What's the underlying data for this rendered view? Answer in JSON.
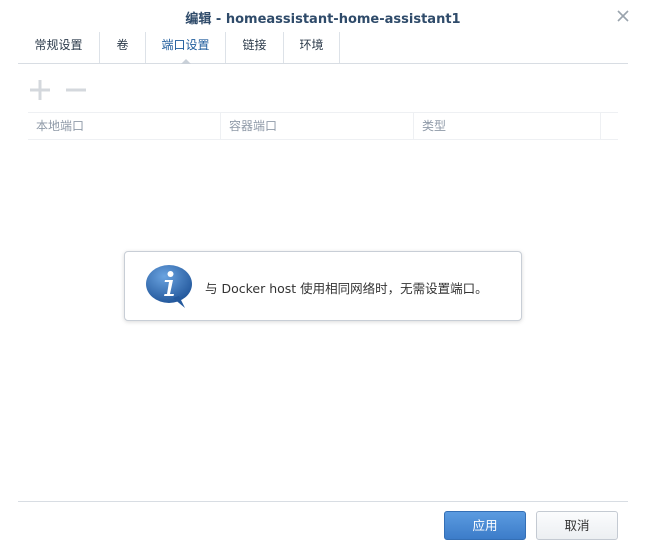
{
  "window": {
    "title": "编辑 - homeassistant-home-assistant1"
  },
  "tabs": [
    {
      "label": "常规设置"
    },
    {
      "label": "卷"
    },
    {
      "label": "端口设置",
      "active": true
    },
    {
      "label": "链接"
    },
    {
      "label": "环境"
    }
  ],
  "toolbar": {
    "add_icon": "plus-icon",
    "remove_icon": "minus-icon"
  },
  "table": {
    "columns": [
      "本地端口",
      "容器端口",
      "类型"
    ],
    "rows": []
  },
  "info": {
    "icon": "info-bubble-icon",
    "message": "与 Docker host 使用相同网络时，无需设置端口。"
  },
  "footer": {
    "apply_label": "应用",
    "cancel_label": "取消"
  },
  "colors": {
    "title": "#2f4b6a",
    "accent": "#3c7cc9",
    "info_icon": "#2f6db3"
  }
}
